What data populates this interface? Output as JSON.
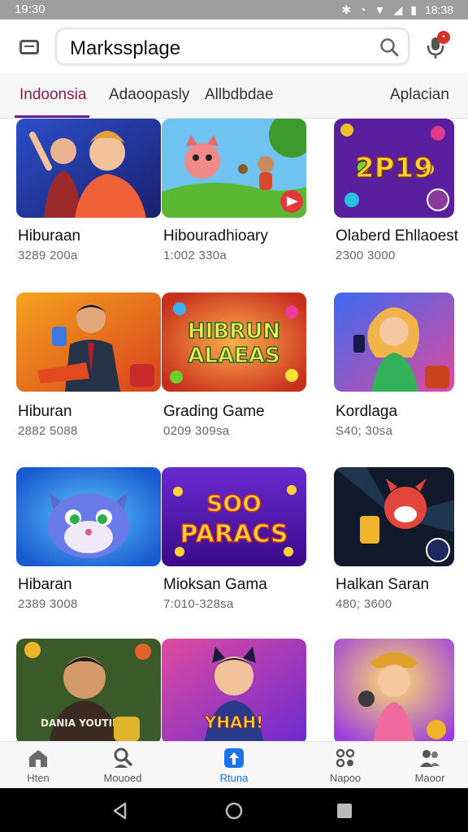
{
  "status_bar": {
    "time": "19:30",
    "clock": "18:38"
  },
  "search": {
    "value": "Markssplage"
  },
  "tabs": [
    {
      "label": "Indoonsia",
      "active": true
    },
    {
      "label": "Adaoopasly",
      "active": false
    },
    {
      "label": "Allbdbdae",
      "active": false
    },
    {
      "label": "Aplacian",
      "active": false
    }
  ],
  "cards": [
    {
      "title": "Hiburaan",
      "sub": "3289 200a"
    },
    {
      "title": "Hibouradhioary",
      "sub": "1:002 330a"
    },
    {
      "title": "Olaberd Ehllaoest",
      "sub": "2300 3000"
    },
    {
      "title": "Hiburan",
      "sub": "2882 5088"
    },
    {
      "title": "Grading Game",
      "sub": "0209 309sa"
    },
    {
      "title": "Kordlaga",
      "sub": "S40; 30sa"
    },
    {
      "title": "Hibaran",
      "sub": "2389 3008"
    },
    {
      "title": "Mioksan Gama",
      "sub": "7:010-328sa"
    },
    {
      "title": "Halkan Saran",
      "sub": "480; 3600"
    },
    {
      "title": "",
      "sub": ""
    },
    {
      "title": "",
      "sub": ""
    },
    {
      "title": "",
      "sub": ""
    }
  ],
  "thumb_text": {
    "card3": "2P19",
    "card5_line1": "HIBRUN",
    "card5_line2": "ALAEAS",
    "card8_line1": "SOO",
    "card8_line2": "PARACS",
    "card10": "DANIA YOUTING",
    "card11": "YHAH!"
  },
  "bottom_nav": [
    {
      "label": "Hten",
      "icon": "home-icon",
      "active": false
    },
    {
      "label": "Mouoed",
      "icon": "search-person-icon",
      "active": false
    },
    {
      "label": "Rtuna",
      "icon": "upload-icon",
      "active": true
    },
    {
      "label": "Napoo",
      "icon": "apps-icon",
      "active": false
    },
    {
      "label": "Maoor",
      "icon": "people-icon",
      "active": false
    }
  ],
  "colors": {
    "accent": "#1a73e8",
    "tab_active": "#8a1c4f",
    "indicator": "#6a1b9a",
    "badge": "#d93025"
  }
}
